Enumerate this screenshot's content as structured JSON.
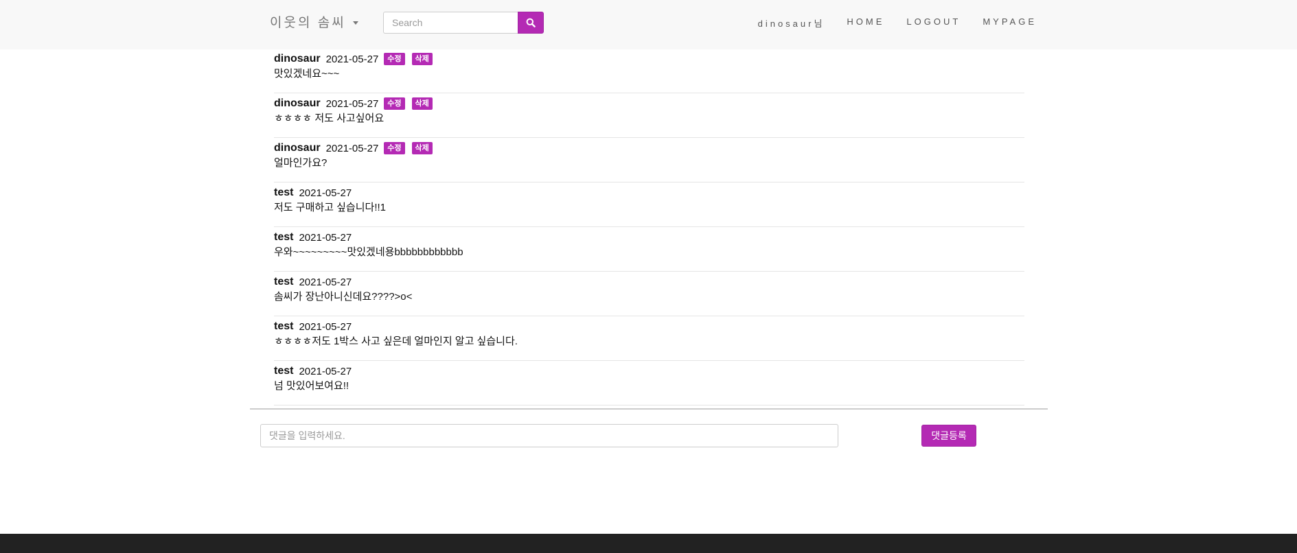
{
  "header": {
    "brand": "이웃의 솜씨",
    "search_placeholder": "Search",
    "nav": {
      "user": "dinosaur님",
      "home": "HOME",
      "logout": "LOGOUT",
      "mypage": "MYPAGE"
    }
  },
  "comment_buttons": {
    "edit": "수정",
    "delete": "삭제"
  },
  "comments": [
    {
      "author": "dinosaur",
      "date": "2021-05-27",
      "text": "맛있겠네요~~~"
    },
    {
      "author": "dinosaur",
      "date": "2021-05-27",
      "text": "ㅎㅎㅎㅎ 저도 사고싶어요"
    },
    {
      "author": "dinosaur",
      "date": "2021-05-27",
      "text": "얼마인가요?"
    },
    {
      "author": "test",
      "date": "2021-05-27",
      "text": "저도 구매하고 싶습니다!!1"
    },
    {
      "author": "test",
      "date": "2021-05-27",
      "text": "우와~~~~~~~~~맛있겠네용bbbbbbbbbbbb"
    },
    {
      "author": "test",
      "date": "2021-05-27",
      "text": "솜씨가 장난아니신데요????>o<"
    },
    {
      "author": "test",
      "date": "2021-05-27",
      "text": "ㅎㅎㅎㅎ저도 1박스 사고 싶은데 얼마인지 알고 싶습니다."
    },
    {
      "author": "test",
      "date": "2021-05-27",
      "text": "넘 맛있어보여요!!"
    }
  ],
  "comment_form": {
    "placeholder": "댓글을 입력하세요.",
    "submit_label": "댓글등록"
  },
  "colors": {
    "accent": "#b42ab4",
    "navbar_bg": "#f8f8f8",
    "footer_bg": "#222222"
  }
}
